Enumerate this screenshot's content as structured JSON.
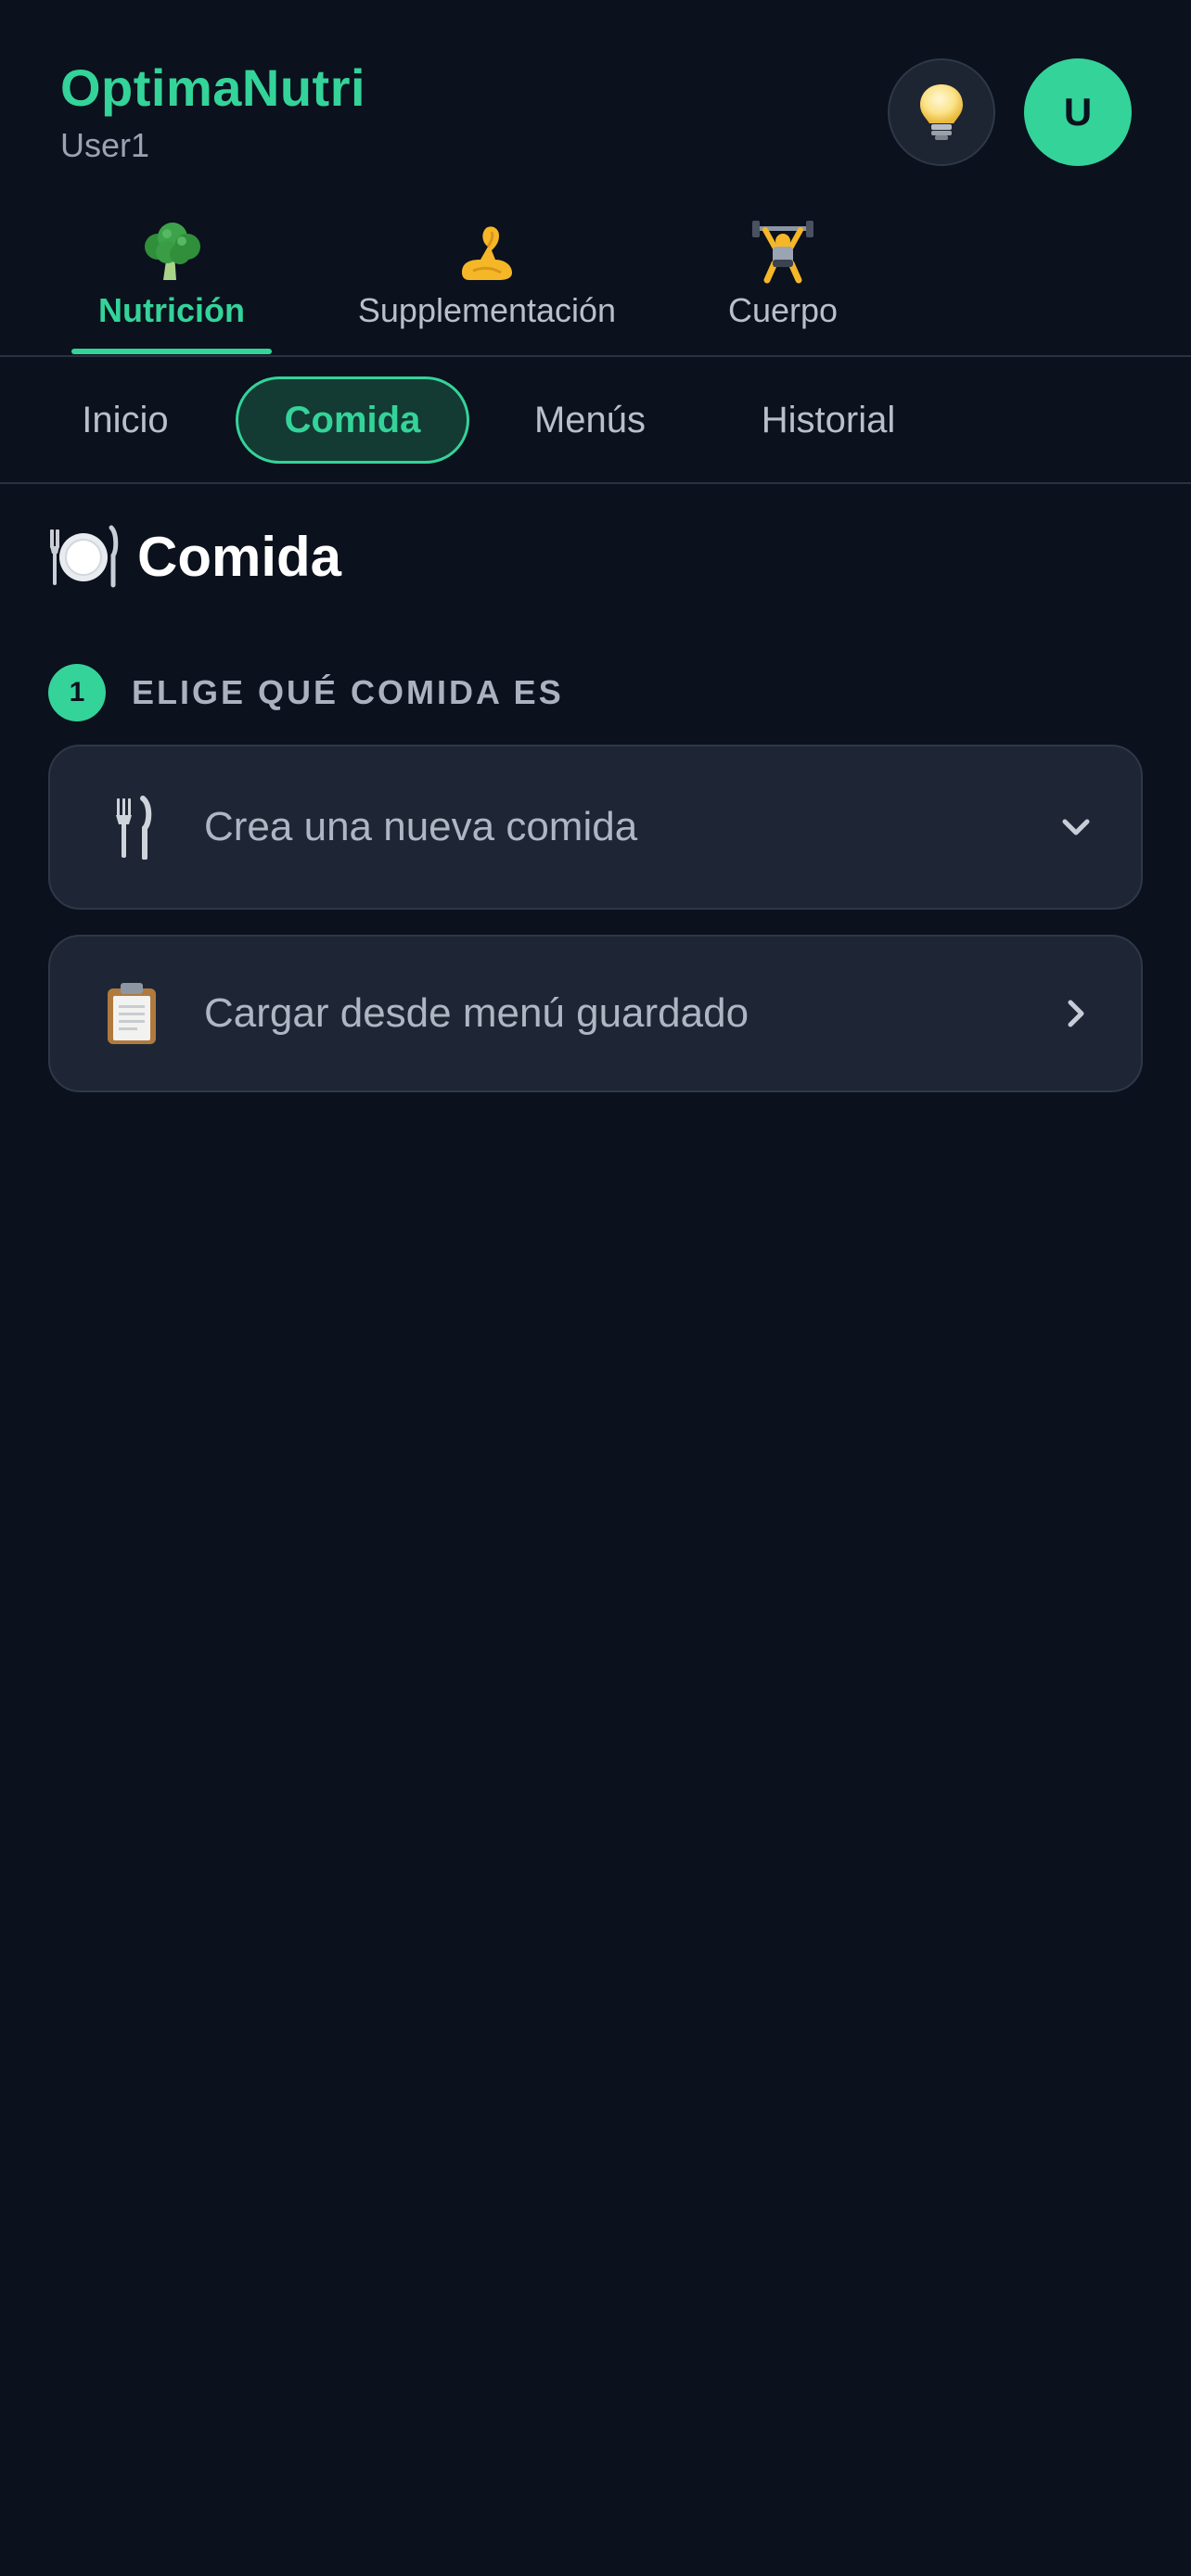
{
  "header": {
    "app_title": "OptimaNutri",
    "user_name": "User1",
    "avatar_initial": "U"
  },
  "top_tabs": [
    {
      "label": "Nutrición",
      "icon": "broccoli-icon",
      "active": true
    },
    {
      "label": "Supplementación",
      "icon": "flexed-biceps-icon",
      "active": false
    },
    {
      "label": "Cuerpo",
      "icon": "weightlifter-icon",
      "active": false
    }
  ],
  "sub_tabs": [
    {
      "label": "Inicio",
      "active": false
    },
    {
      "label": "Comida",
      "active": true
    },
    {
      "label": "Menús",
      "active": false
    },
    {
      "label": "Historial",
      "active": false
    }
  ],
  "main": {
    "title": "Comida",
    "title_icon": "plate-fork-knife-icon",
    "step_number": "1",
    "step_text": "ELIGE QUÉ COMIDA ES",
    "options": [
      {
        "label": "Crea una nueva comida",
        "icon": "fork-knife-icon",
        "indicator": "chevron-down-icon"
      },
      {
        "label": "Cargar desde menú guardado",
        "icon": "clipboard-icon",
        "indicator": "chevron-right-icon"
      }
    ]
  },
  "colors": {
    "background": "#0b111d",
    "accent": "#34d399",
    "card": "#1e2636",
    "muted_text": "#aeb6c3"
  }
}
